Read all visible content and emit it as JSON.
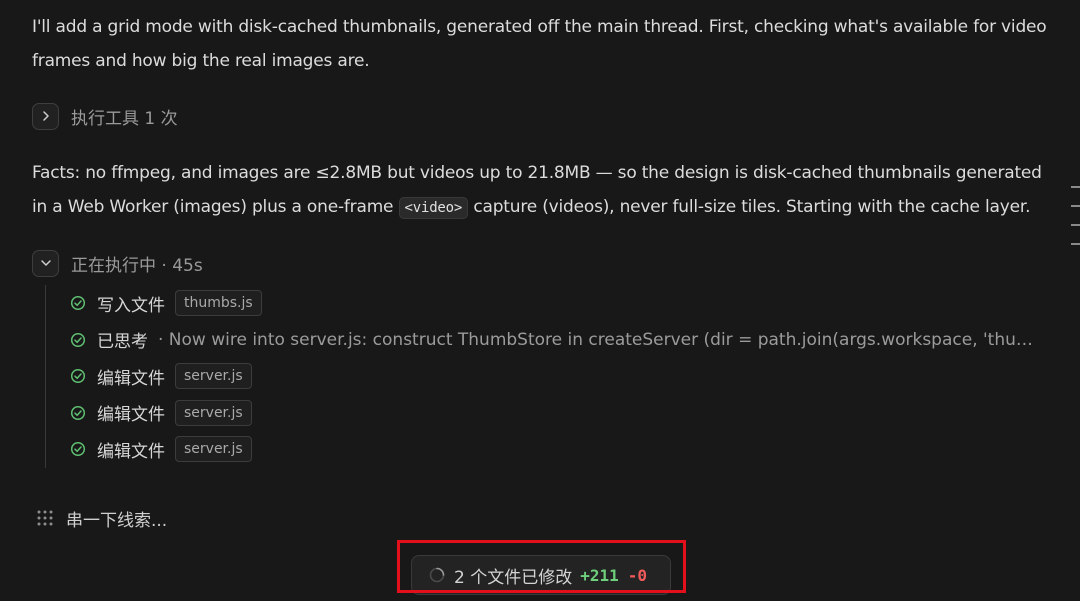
{
  "message": {
    "intro": "I'll add a grid mode with disk-cached thumbnails, generated off the main thread. First, checking what's available for video frames and how big the real images are.",
    "facts_before": "Facts: no ffmpeg, and images are ≤2.8MB but videos up to 21.8MB — so the design is disk-cached thumbnails generated in a Web Worker (images) plus a one-frame ",
    "facts_code": "<video>",
    "facts_after": " capture (videos), never full-size tiles. Starting with the cache layer."
  },
  "tool_group_1": {
    "label": "执行工具 1 次",
    "icon": "chevron-right-icon"
  },
  "tool_group_2": {
    "label": "正在执行中 · 45s",
    "icon": "chevron-down-icon",
    "steps": [
      {
        "label": "写入文件",
        "file": "thumbs.js"
      },
      {
        "label": "已思考",
        "thought": "· Now wire into server.js: construct ThumbStore in createServer (dir = path.join(args.workspace, 'thumbs')) en..."
      },
      {
        "label": "编辑文件",
        "file": "server.js"
      },
      {
        "label": "编辑文件",
        "file": "server.js"
      },
      {
        "label": "编辑文件",
        "file": "server.js"
      }
    ]
  },
  "status": {
    "clue_text": "串一下线索...",
    "icon": "dots-grid-icon"
  },
  "changes": {
    "text": "2 个文件已修改",
    "additions": "+211",
    "deletions": "-0",
    "icon": "spinner-icon"
  },
  "colors": {
    "background": "#181818",
    "highlight": "#e3101b",
    "added": "#6fcf7d",
    "removed": "#f05a5a"
  }
}
